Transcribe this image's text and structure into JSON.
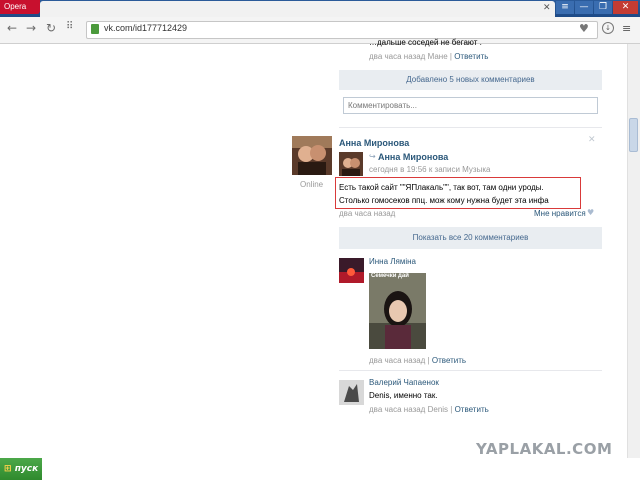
{
  "browser": {
    "menu_label": "Opera",
    "url": "vk.com/id177712429",
    "window_buttons": [
      "≡",
      "—",
      "❐",
      "✕"
    ],
    "tab_close": "✕",
    "icons": [
      "back-icon",
      "forward-icon",
      "reload-icon",
      "speed-dial-icon",
      "lock-icon",
      "heart-icon",
      "download-icon",
      "menu-icon"
    ]
  },
  "feed": {
    "top_comment_tail": "…дальше соседей не бегают .",
    "top_comment_meta_time": "два часа назад",
    "top_comment_meta_author": "Мане",
    "reply_label": "Ответить",
    "added_comments_label": "Добавлено 5 новых комментариев",
    "comment_placeholder": "Комментировать...",
    "post": {
      "author": "Анна Миронова",
      "status": "Online",
      "repost_author": "Анна Миронова",
      "repost_meta": "сегодня в 19:56 к записи Музыка",
      "text_line1": "Есть такой сайт \"\"ЯПлакаль\"\", так вот, там одни уроды.",
      "text_line2": "Столько гомосеков ппц. мож кому нужна будет эта инфа",
      "time": "два часа назад",
      "like_label": "Мне нравится"
    },
    "show_all_label": "Показать все 20 комментариев",
    "comments": [
      {
        "author": "Инна Ляміна",
        "photo_caption": "Семечки дай",
        "time": "два часа назад",
        "reply": "Ответить"
      },
      {
        "author": "Валерий Чапаенок",
        "text": "Denis, именно так.",
        "time": "два часа назад",
        "to": "Denis",
        "reply": "Ответить"
      }
    ]
  },
  "watermark": "YAPLAKAL.COM",
  "taskbar": {
    "start_label": "пуск"
  }
}
